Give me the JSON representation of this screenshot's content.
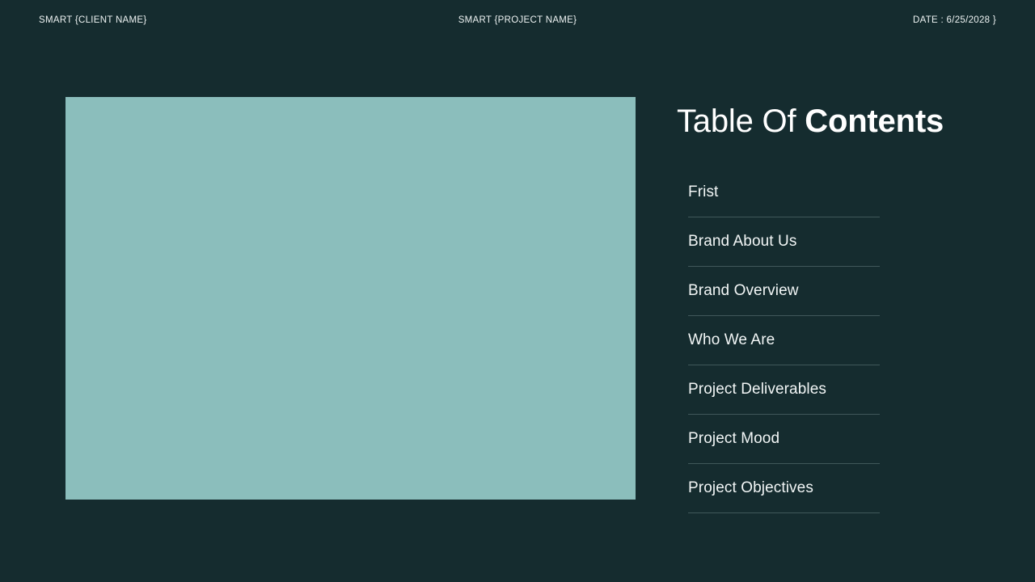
{
  "theme": {
    "background": "#152c2f",
    "image_placeholder": "#8bbebc",
    "text": "#ffffff",
    "divider": "#40585a"
  },
  "header": {
    "client": "SMART {CLIENT NAME}",
    "project": "SMART {PROJECT NAME}",
    "date": "DATE : 6/25/2028 }"
  },
  "hero": {
    "alt": "image-placeholder"
  },
  "contents": {
    "title_light": "Table Of ",
    "title_bold": "Contents",
    "items": [
      {
        "label": "Frist"
      },
      {
        "label": "Brand About Us"
      },
      {
        "label": "Brand Overview"
      },
      {
        "label": "Who We Are"
      },
      {
        "label": "Project Deliverables"
      },
      {
        "label": "Project Mood"
      },
      {
        "label": "Project Objectives"
      }
    ]
  }
}
